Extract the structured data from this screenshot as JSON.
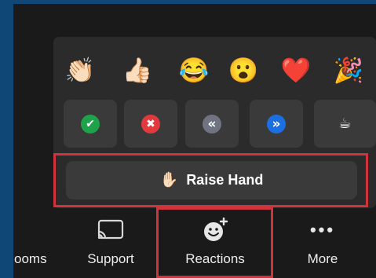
{
  "reactions_popup": {
    "emojis": [
      {
        "name": "clapping-hands",
        "glyph": "👏🏻"
      },
      {
        "name": "thumbs-up",
        "glyph": "👍🏻"
      },
      {
        "name": "tears-of-joy",
        "glyph": "😂"
      },
      {
        "name": "open-mouth",
        "glyph": "😮"
      },
      {
        "name": "red-heart",
        "glyph": "❤️"
      },
      {
        "name": "party-popper",
        "glyph": "🎉"
      }
    ],
    "status_buttons": [
      {
        "name": "yes",
        "glyph": "✔",
        "color": "#1fa34a"
      },
      {
        "name": "no",
        "glyph": "✖",
        "color": "#e03a3e"
      },
      {
        "name": "slow-down",
        "glyph": "«",
        "color": "#6f7480"
      },
      {
        "name": "speed-up",
        "glyph": "»",
        "color": "#1b6fe0"
      },
      {
        "name": "coffee",
        "glyph": "☕",
        "color": "#3a3a3a"
      }
    ],
    "raise_hand": {
      "icon": "✋🏻",
      "label": "Raise Hand"
    }
  },
  "toolbar": {
    "partial_label": "ooms",
    "support_label": "Support",
    "reactions_label": "Reactions",
    "more_label": "More",
    "more_icon": "•••"
  },
  "colors": {
    "highlight": "#d0333b",
    "background_blue": "#0f4777",
    "panel": "#2b2b2b",
    "button": "#3a3a3a"
  }
}
